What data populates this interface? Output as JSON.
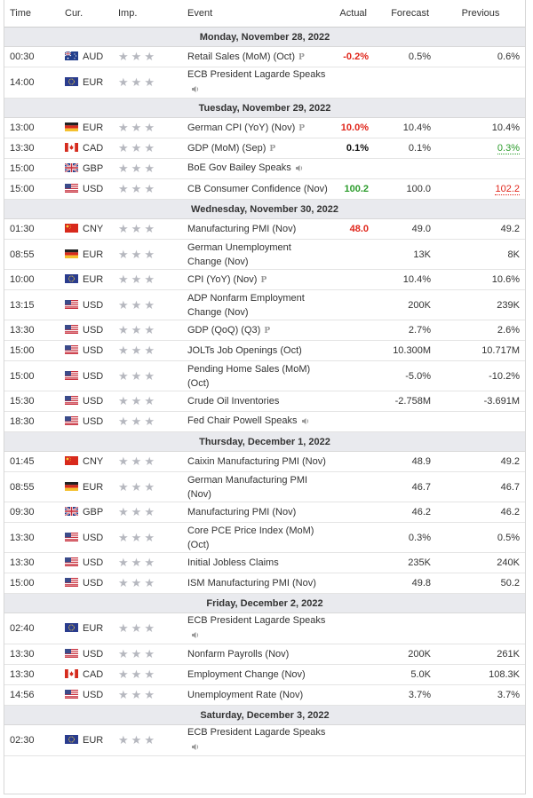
{
  "headers": {
    "time": "Time",
    "cur": "Cur.",
    "imp": "Imp.",
    "event": "Event",
    "actual": "Actual",
    "forecast": "Forecast",
    "previous": "Previous"
  },
  "colors": {
    "negative": "#e0261b",
    "positive": "#2c9c2c",
    "day_band": "#e9eaee",
    "star": "#b6b8bf"
  },
  "days": [
    {
      "label": "Monday, November 28, 2022",
      "events": [
        {
          "time": "00:30",
          "cur": "AUD",
          "flag": "au",
          "event": "Retail Sales (MoM) (Oct)",
          "icon": "preliminary-icon",
          "actual": "-0.2%",
          "actual_style": "neg",
          "forecast": "0.5%",
          "previous": "0.6%",
          "previous_style": ""
        },
        {
          "time": "14:00",
          "cur": "EUR",
          "flag": "eu",
          "event": "ECB President Lagarde Speaks",
          "icon": "speaker-icon",
          "icon_newline": true,
          "actual": "",
          "forecast": "",
          "previous": ""
        }
      ]
    },
    {
      "label": "Tuesday, November 29, 2022",
      "events": [
        {
          "time": "13:00",
          "cur": "EUR",
          "flag": "de",
          "event": "German CPI (YoY) (Nov)",
          "icon": "preliminary-icon",
          "actual": "10.0%",
          "actual_style": "neg",
          "forecast": "10.4%",
          "previous": "10.4%"
        },
        {
          "time": "13:30",
          "cur": "CAD",
          "flag": "ca",
          "event": "GDP (MoM) (Sep)",
          "icon": "preliminary-icon",
          "actual": "0.1%",
          "actual_style": "black",
          "forecast": "0.1%",
          "previous": "0.3%",
          "previous_style": "pos und"
        },
        {
          "time": "15:00",
          "cur": "GBP",
          "flag": "gb",
          "event": "BoE Gov Bailey Speaks",
          "icon": "speaker-icon",
          "actual": "",
          "forecast": "",
          "previous": ""
        },
        {
          "time": "15:00",
          "cur": "USD",
          "flag": "us",
          "event": "CB Consumer Confidence (Nov)",
          "icon": "",
          "actual": "100.2",
          "actual_style": "pos",
          "forecast": "100.0",
          "previous": "102.2",
          "previous_style": "neg und"
        }
      ]
    },
    {
      "label": "Wednesday, November 30, 2022",
      "events": [
        {
          "time": "01:30",
          "cur": "CNY",
          "flag": "cn",
          "event": "Manufacturing PMI (Nov)",
          "icon": "",
          "actual": "48.0",
          "actual_style": "neg",
          "forecast": "49.0",
          "previous": "49.2"
        },
        {
          "time": "08:55",
          "cur": "EUR",
          "flag": "de",
          "event": "German Unemployment Change (Nov)",
          "icon": "",
          "tall": true,
          "actual": "",
          "forecast": "13K",
          "previous": "8K"
        },
        {
          "time": "10:00",
          "cur": "EUR",
          "flag": "eu",
          "event": "CPI (YoY) (Nov)",
          "icon": "preliminary-icon",
          "actual": "",
          "forecast": "10.4%",
          "previous": "10.6%"
        },
        {
          "time": "13:15",
          "cur": "USD",
          "flag": "us",
          "event": "ADP Nonfarm Employment Change (Nov)",
          "icon": "",
          "tall": true,
          "actual": "",
          "forecast": "200K",
          "previous": "239K"
        },
        {
          "time": "13:30",
          "cur": "USD",
          "flag": "us",
          "event": "GDP (QoQ) (Q3)",
          "icon": "preliminary-icon",
          "actual": "",
          "forecast": "2.7%",
          "previous": "2.6%"
        },
        {
          "time": "15:00",
          "cur": "USD",
          "flag": "us",
          "event": "JOLTs Job Openings (Oct)",
          "icon": "",
          "actual": "",
          "forecast": "10.300M",
          "previous": "10.717M"
        },
        {
          "time": "15:00",
          "cur": "USD",
          "flag": "us",
          "event": "Pending Home Sales (MoM) (Oct)",
          "icon": "",
          "tall": true,
          "actual": "",
          "forecast": "-5.0%",
          "previous": "-10.2%"
        },
        {
          "time": "15:30",
          "cur": "USD",
          "flag": "us",
          "event": "Crude Oil Inventories",
          "icon": "",
          "actual": "",
          "forecast": "-2.758M",
          "previous": "-3.691M"
        },
        {
          "time": "18:30",
          "cur": "USD",
          "flag": "us",
          "event": "Fed Chair Powell Speaks",
          "icon": "speaker-icon",
          "actual": "",
          "forecast": "",
          "previous": ""
        }
      ]
    },
    {
      "label": "Thursday, December 1, 2022",
      "events": [
        {
          "time": "01:45",
          "cur": "CNY",
          "flag": "cn",
          "event": "Caixin Manufacturing PMI (Nov)",
          "icon": "",
          "actual": "",
          "forecast": "48.9",
          "previous": "49.2"
        },
        {
          "time": "08:55",
          "cur": "EUR",
          "flag": "de",
          "event": "German Manufacturing PMI (Nov)",
          "icon": "",
          "tall": true,
          "actual": "",
          "forecast": "46.7",
          "previous": "46.7"
        },
        {
          "time": "09:30",
          "cur": "GBP",
          "flag": "gb",
          "event": "Manufacturing PMI (Nov)",
          "icon": "",
          "actual": "",
          "forecast": "46.2",
          "previous": "46.2"
        },
        {
          "time": "13:30",
          "cur": "USD",
          "flag": "us",
          "event": "Core PCE Price Index (MoM) (Oct)",
          "icon": "",
          "tall": true,
          "actual": "",
          "forecast": "0.3%",
          "previous": "0.5%"
        },
        {
          "time": "13:30",
          "cur": "USD",
          "flag": "us",
          "event": "Initial Jobless Claims",
          "icon": "",
          "actual": "",
          "forecast": "235K",
          "previous": "240K"
        },
        {
          "time": "15:00",
          "cur": "USD",
          "flag": "us",
          "event": "ISM Manufacturing PMI (Nov)",
          "icon": "",
          "actual": "",
          "forecast": "49.8",
          "previous": "50.2"
        }
      ]
    },
    {
      "label": "Friday, December 2, 2022",
      "events": [
        {
          "time": "02:40",
          "cur": "EUR",
          "flag": "eu",
          "event": "ECB President Lagarde Speaks",
          "icon": "speaker-icon",
          "icon_newline": true,
          "actual": "",
          "forecast": "",
          "previous": ""
        },
        {
          "time": "13:30",
          "cur": "USD",
          "flag": "us",
          "event": "Nonfarm Payrolls (Nov)",
          "icon": "",
          "actual": "",
          "forecast": "200K",
          "previous": "261K"
        },
        {
          "time": "13:30",
          "cur": "CAD",
          "flag": "ca",
          "event": "Employment Change (Nov)",
          "icon": "",
          "actual": "",
          "forecast": "5.0K",
          "previous": "108.3K"
        },
        {
          "time": "14:56",
          "cur": "USD",
          "flag": "us",
          "event": "Unemployment Rate (Nov)",
          "icon": "",
          "actual": "",
          "forecast": "3.7%",
          "previous": "3.7%"
        }
      ]
    },
    {
      "label": "Saturday, December 3, 2022",
      "events": [
        {
          "time": "02:30",
          "cur": "EUR",
          "flag": "eu",
          "event": "ECB President Lagarde Speaks",
          "icon": "speaker-icon",
          "icon_newline": true,
          "actual": "",
          "forecast": "",
          "previous": ""
        }
      ]
    }
  ]
}
